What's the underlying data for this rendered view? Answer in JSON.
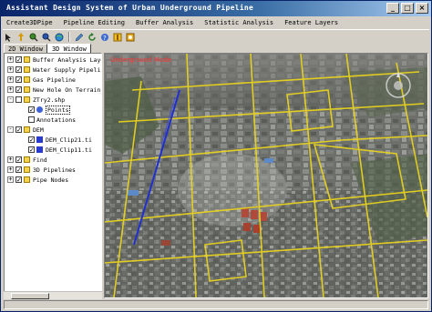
{
  "window": {
    "title": "Assistant Design System of Urban Underground Pipeline",
    "minimize": "_",
    "maximize": "□",
    "close": "×"
  },
  "menu": [
    "Create3DPipe",
    "Pipeline Editing",
    "Buffer Analysis",
    "Statistic Analysis",
    "Feature Layers"
  ],
  "toolbar": {
    "icons": [
      "select-arrow-icon",
      "pan-icon",
      "zoom-in-icon",
      "zoom-out-icon",
      "globe-icon",
      "edit-icon",
      "refresh-icon",
      "help-icon",
      "info-icon",
      "settings-icon"
    ]
  },
  "tabs": [
    "2D Window",
    "3D Window"
  ],
  "active_tab": "3D Window",
  "tree": {
    "items": [
      {
        "label": "Buffer Analysis Layer",
        "expand": "+",
        "checked": true,
        "type": "folder"
      },
      {
        "label": "Water Supply Pipeline",
        "expand": "+",
        "checked": true,
        "type": "folder"
      },
      {
        "label": "Gas Pipeline",
        "expand": "+",
        "checked": true,
        "type": "folder"
      },
      {
        "label": "New Hole On Terrain ##",
        "expand": "+",
        "checked": true,
        "type": "folder"
      },
      {
        "label": "ZTry2.shp",
        "expand": "-",
        "checked": false,
        "type": "folder"
      },
      {
        "label": "Points",
        "expand": "",
        "checked": true,
        "type": "point",
        "selected": true
      },
      {
        "label": "Annotations",
        "expand": "",
        "checked": false,
        "type": "none"
      },
      {
        "label": "DEM",
        "expand": "-",
        "checked": true,
        "type": "folder"
      },
      {
        "label": "DEM_Clip21.ti",
        "expand": "",
        "checked": true,
        "type": "raster"
      },
      {
        "label": "DEM_Clip11.ti",
        "expand": "",
        "checked": true,
        "type": "raster"
      },
      {
        "label": "Find",
        "expand": "+",
        "checked": true,
        "type": "folder"
      },
      {
        "label": "3D Pipelines",
        "expand": "+",
        "checked": true,
        "type": "folder"
      },
      {
        "label": "Pipe Nodes",
        "expand": "+",
        "checked": true,
        "type": "folder"
      }
    ]
  },
  "map": {
    "mode_label": "Underground Mode"
  },
  "colors": {
    "title_start": "#0a246a",
    "title_end": "#a6caf0",
    "road": "#e8d21e",
    "pipeline": "#2030d0",
    "mode_label": "#ff3030"
  }
}
